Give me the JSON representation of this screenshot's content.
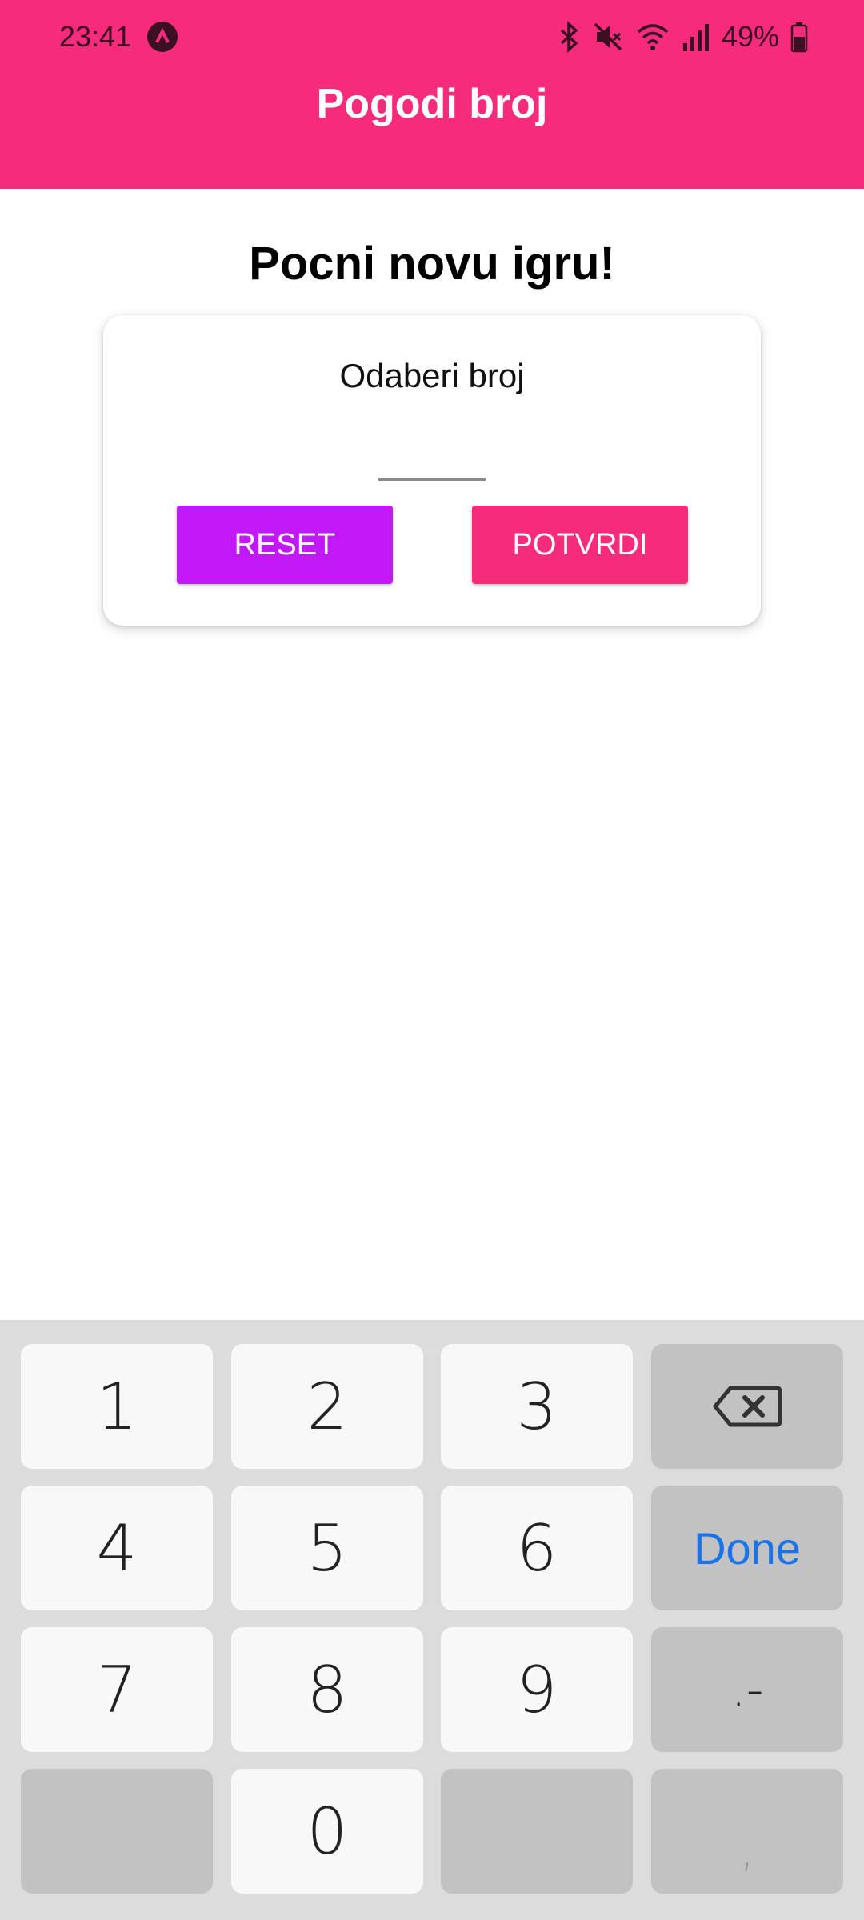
{
  "status_bar": {
    "time": "23:41",
    "battery": "49%"
  },
  "app_bar": {
    "title": "Pogodi broj"
  },
  "main": {
    "headline": "Pocni novu igru!",
    "card": {
      "label": "Odaberi broj",
      "input_value": "",
      "reset_label": "RESET",
      "confirm_label": "POTVRDI"
    }
  },
  "keyboard": {
    "keys": [
      "1",
      "2",
      "3",
      "4",
      "5",
      "6",
      "7",
      "8",
      "9",
      "0"
    ],
    "done_label": "Done",
    "dot_dash": ".-",
    "comma": ","
  },
  "colors": {
    "primary": "#f72b7c",
    "accent": "#c218f8",
    "done_text": "#1a73e8"
  },
  "icons": [
    "bluetooth-icon",
    "mute-icon",
    "wifi-icon",
    "signal-icon",
    "battery-icon",
    "backspace-icon",
    "app-notification-icon"
  ]
}
